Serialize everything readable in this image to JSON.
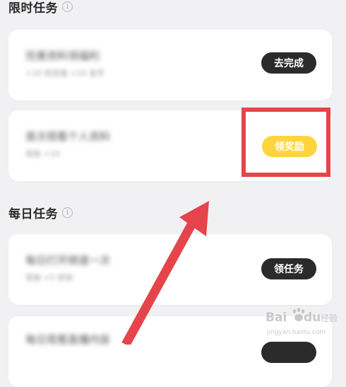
{
  "sections": [
    {
      "title": "限时任务"
    },
    {
      "title": "每日任务"
    }
  ],
  "limited_tasks": [
    {
      "title": "完善资料领福利",
      "subtitle": "+10 经验值 +10 金币",
      "button": "去完成"
    },
    {
      "title": "首次观看个人资料",
      "subtitle": "奖励 +10",
      "button": "领奖励"
    }
  ],
  "daily_tasks": [
    {
      "title": "每日打开频道一次",
      "subtitle": "奖励 +5 经验",
      "button": "领任务"
    },
    {
      "title": "每日观看直播内容",
      "subtitle": "",
      "button": ""
    }
  ],
  "colors": {
    "background": "#f1f1f3",
    "dark_button": "#2b2b2b",
    "reward_button": "#ffd43d",
    "annotation_red": "#e5454a"
  },
  "icons": {
    "info": "info-circle-icon",
    "arrow": "annotation-arrow-icon"
  },
  "watermark": {
    "text": "Bai du 经验",
    "sub": "jingyan.baidu.com"
  }
}
